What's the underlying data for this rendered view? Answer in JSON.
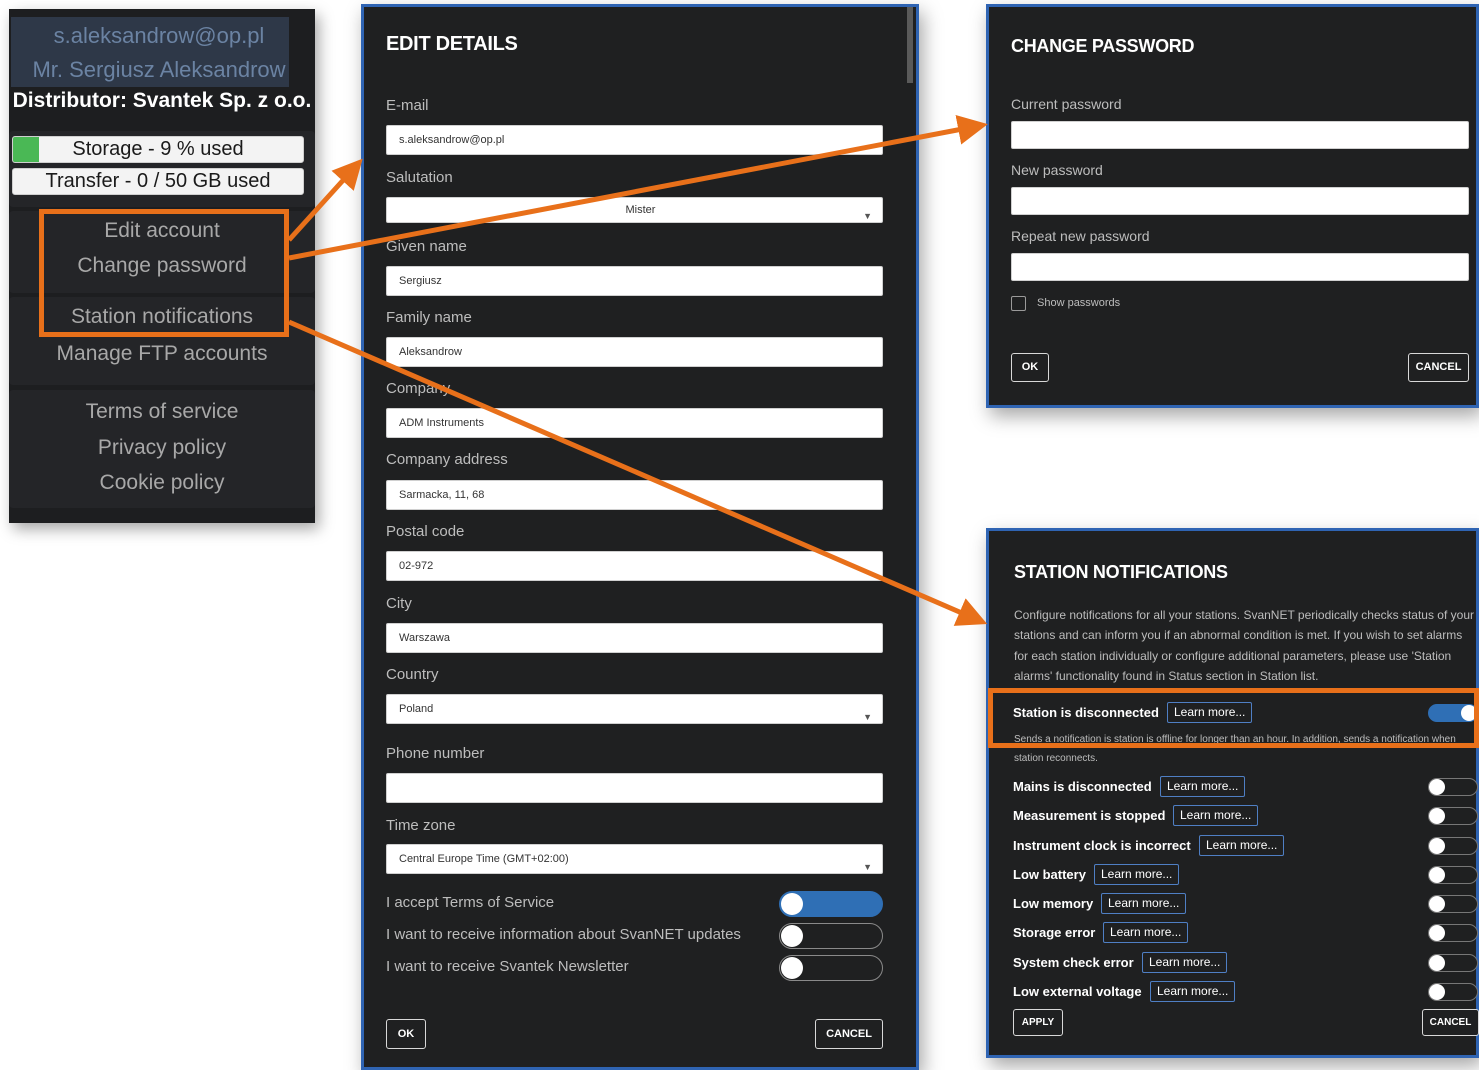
{
  "account_menu": {
    "email": "s.aleksandrow@op.pl",
    "name": "Mr. Sergiusz Aleksandrow",
    "distributor": "Distributor: Svantek Sp. z o.o.",
    "storage_label": "Storage - 9 % used",
    "storage_fraction": 0.09,
    "transfer_label": "Transfer - 0 / 50 GB used",
    "transfer_fraction": 0.0,
    "items": {
      "edit_account": "Edit account",
      "change_password": "Change password",
      "station_notifications": "Station notifications",
      "manage_ftp": "Manage FTP accounts",
      "terms": "Terms of service",
      "privacy": "Privacy policy",
      "cookie": "Cookie policy"
    }
  },
  "edit_details": {
    "title": "EDIT DETAILS",
    "email_label": "E-mail",
    "email_value": "s.aleksandrow@op.pl",
    "salutation_label": "Salutation",
    "salutation_value": "Mister",
    "given_name_label": "Given name",
    "given_name_value": "Sergiusz",
    "family_name_label": "Family name",
    "family_name_value": "Aleksandrow",
    "company_label": "Company",
    "company_value": "ADM Instruments",
    "company_address_label": "Company address",
    "company_address_value": "Sarmacka, 11, 68",
    "postal_code_label": "Postal code",
    "postal_code_value": "02-972",
    "city_label": "City",
    "city_value": "Warszawa",
    "country_label": "Country",
    "country_value": "Poland",
    "phone_label": "Phone number",
    "phone_value": "",
    "timezone_label": "Time zone",
    "timezone_value": "Central Europe Time (GMT+02:00)",
    "accept_terms_label": "I accept Terms of Service",
    "accept_terms_on": true,
    "updates_label": "I want to receive information about SvanNET updates",
    "updates_on": false,
    "newsletter_label": "I want to receive Svantek Newsletter",
    "newsletter_on": false,
    "ok_label": "OK",
    "cancel_label": "CANCEL"
  },
  "change_password": {
    "title": "CHANGE PASSWORD",
    "current_label": "Current password",
    "new_label": "New password",
    "repeat_label": "Repeat new password",
    "show_label": "Show passwords",
    "ok_label": "OK",
    "cancel_label": "CANCEL"
  },
  "station_notifications": {
    "title": "STATION NOTIFICATIONS",
    "description": "Configure notifications for all your stations. SvanNET periodically checks status of your stations and can inform you if an abnormal condition is met. If you wish to set alarms for each station individually or configure additional parameters, please use 'Station alarms' functionality found in Status section in Station list.",
    "learn_more": "Learn more...",
    "highlighted_desc": "Sends a notification is station is offline for longer than an hour. In addition, sends a notification when station reconnects.",
    "items": [
      {
        "label": "Station is disconnected",
        "on": true
      },
      {
        "label": "Mains is disconnected",
        "on": false
      },
      {
        "label": "Measurement is stopped",
        "on": false
      },
      {
        "label": "Instrument clock is incorrect",
        "on": false
      },
      {
        "label": "Low battery",
        "on": false
      },
      {
        "label": "Low memory",
        "on": false
      },
      {
        "label": "Storage error",
        "on": false
      },
      {
        "label": "System check error",
        "on": false
      },
      {
        "label": "Low external voltage",
        "on": false
      }
    ],
    "apply_label": "APPLY",
    "cancel_label": "CANCEL"
  },
  "colors": {
    "accent": "#e8701a",
    "toggle_on": "#2f6fb5",
    "dialog_border": "#2f64b3",
    "storage_fill": "#4ab855"
  }
}
